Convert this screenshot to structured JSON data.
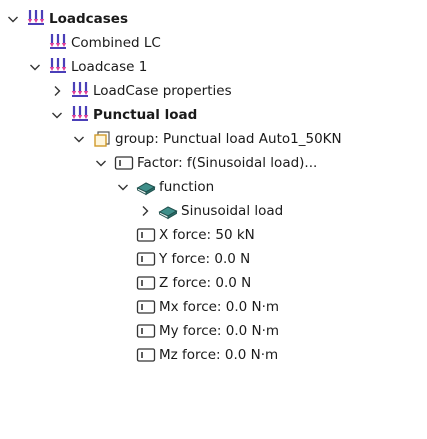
{
  "tree": {
    "nodes": [
      {
        "id": "loadcases",
        "label": "Loadcases",
        "depth": 0,
        "toggle": "expanded",
        "icon": "load-arrows-icon",
        "bold": true
      },
      {
        "id": "combined-lc",
        "label": "Combined LC",
        "depth": 1,
        "toggle": "none",
        "icon": "load-arrows-icon",
        "bold": false
      },
      {
        "id": "loadcase-1",
        "label": "Loadcase 1",
        "depth": 1,
        "toggle": "expanded",
        "icon": "load-arrows-icon",
        "bold": false
      },
      {
        "id": "loadcase-properties",
        "label": "LoadCase properties",
        "depth": 2,
        "toggle": "collapsed",
        "icon": "load-arrows-icon",
        "bold": false
      },
      {
        "id": "punctual-load",
        "label": "Punctual load",
        "depth": 2,
        "toggle": "expanded",
        "icon": "load-arrows-icon",
        "bold": true
      },
      {
        "id": "group-punctual",
        "label": "group: Punctual load Auto1_50KN",
        "depth": 3,
        "toggle": "expanded",
        "icon": "group-icon",
        "bold": false
      },
      {
        "id": "factor",
        "label": "Factor: f(Sinusoidal load)...",
        "depth": 4,
        "toggle": "expanded",
        "icon": "parameter-box-icon",
        "bold": false
      },
      {
        "id": "function",
        "label": "function",
        "depth": 5,
        "toggle": "expanded",
        "icon": "function-book-icon",
        "bold": false
      },
      {
        "id": "sinusoidal-load",
        "label": "Sinusoidal load",
        "depth": 6,
        "toggle": "collapsed",
        "icon": "function-book-icon",
        "bold": false
      },
      {
        "id": "x-force",
        "label": "X force: 50 kN",
        "depth": 5,
        "toggle": "none",
        "icon": "parameter-box-icon",
        "bold": false
      },
      {
        "id": "y-force",
        "label": "Y force: 0.0 N",
        "depth": 5,
        "toggle": "none",
        "icon": "parameter-box-icon",
        "bold": false
      },
      {
        "id": "z-force",
        "label": "Z force: 0.0 N",
        "depth": 5,
        "toggle": "none",
        "icon": "parameter-box-icon",
        "bold": false
      },
      {
        "id": "mx-force",
        "label": "Mx force: 0.0 N·m",
        "depth": 5,
        "toggle": "none",
        "icon": "parameter-box-icon",
        "bold": false
      },
      {
        "id": "my-force",
        "label": "My force: 0.0 N·m",
        "depth": 5,
        "toggle": "none",
        "icon": "parameter-box-icon",
        "bold": false
      },
      {
        "id": "mz-force",
        "label": "Mz force: 0.0 N·m",
        "depth": 5,
        "toggle": "none",
        "icon": "parameter-box-icon",
        "bold": false
      }
    ]
  },
  "colors": {
    "load_arrow": "#4a3fb8",
    "load_tip": "#e0409a",
    "function_book": "#3f8f8a",
    "group_icon": "#d09a2a",
    "chevron": "#333333"
  }
}
